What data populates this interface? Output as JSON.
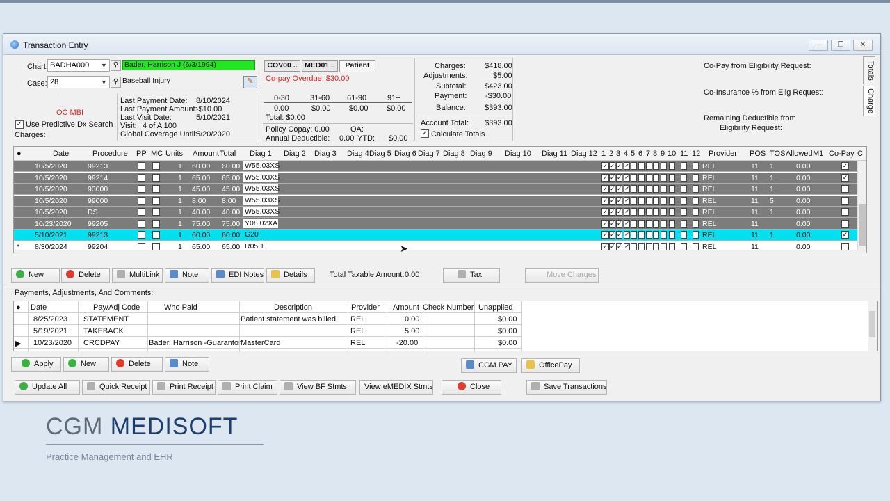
{
  "window": {
    "title": "Transaction Entry",
    "minimize": "—",
    "restore": "❐",
    "close": "✕"
  },
  "patient": {
    "chart_label": "Chart:",
    "chart_value": "BADHA000",
    "patient_name": "Bader, Harrison J (6/3/1994)",
    "case_label": "Case:",
    "case_value": "28",
    "case_desc": "Baseball Injury",
    "oc_mbi": "OC MBI",
    "predictive_label": "Use Predictive Dx Search",
    "charges_label": "Charges:",
    "last_payment_date_label": "Last Payment Date:",
    "last_payment_date": "8/10/2024",
    "last_payment_amount_label": "Last Payment Amount:",
    "last_payment_amount": "-$10.00",
    "last_visit_date_label": "Last Visit Date:",
    "last_visit_date": "5/10/2021",
    "visit_label": "Visit:",
    "visit_value": "4   of  A 100",
    "global_cov_label": "Global Coverage Until:",
    "global_cov_value": "5/20/2020"
  },
  "insurance": {
    "tabs": [
      "COV00 ..",
      "MED01 ..",
      "Patient"
    ],
    "copay_overdue": "Co-pay Overdue: $30.00",
    "aging_headers": [
      "0-30",
      "31-60",
      "61-90",
      "91+"
    ],
    "aging_values": [
      "0.00",
      "$0.00",
      "$0.00",
      "$0.00"
    ],
    "total": "Total: $0.00",
    "policy_copay": "Policy Copay: 0.00",
    "oa": "OA:",
    "annual_deductible": "Annual Deductible:",
    "annual_deductible_value": "0.00",
    "ytd": "YTD:",
    "ytd_value": "$0.00"
  },
  "totals": {
    "charges_label": "Charges:",
    "charges": "$418.00",
    "adjustments_label": "Adjustments:",
    "adjustments": "$5.00",
    "subtotal_label": "Subtotal:",
    "subtotal": "$423.00",
    "payment_label": "Payment:",
    "payment": "-$30.00",
    "balance_label": "Balance:",
    "balance": "$393.00",
    "account_total_label": "Account Total:",
    "account_total": "$393.00",
    "calculate_totals": "Calculate Totals"
  },
  "eligibility": {
    "copay": "Co-Pay from Eligibility Request:",
    "coins": "Co-Insurance % from Elig Request:",
    "deductible_1": "Remaining Deductible from",
    "deductible_2": "Eligibility Request:"
  },
  "side_tabs": [
    "Totals",
    "Charge"
  ],
  "charge_grid": {
    "headers": [
      "Date",
      "Procedure",
      "PP",
      "MC",
      "Units",
      "Amount",
      "Total",
      "Diag 1",
      "Diag 2",
      "Diag 3",
      "Diag 4",
      "Diag 5",
      "Diag 6",
      "Diag 7",
      "Diag 8",
      "Diag 9",
      "Diag 10",
      "Diag 11",
      "Diag 12",
      "1",
      "2",
      "3",
      "4",
      "5",
      "6",
      "7",
      "8",
      "9",
      "10",
      "11",
      "12",
      "Provider",
      "POS",
      "TOS",
      "Allowed",
      "M1",
      "Co-Pay",
      "C"
    ],
    "rows": [
      {
        "date": "10/5/2020",
        "proc": "99213",
        "units": "1",
        "amount": "60.00",
        "total": "60.00",
        "diag1": "W55.03XS",
        "provider": "REL",
        "pos": "11",
        "tos": "1",
        "allowed": "0.00",
        "copay": true
      },
      {
        "date": "10/5/2020",
        "proc": "99214",
        "units": "1",
        "amount": "65.00",
        "total": "65.00",
        "diag1": "W55.03XS",
        "provider": "REL",
        "pos": "11",
        "tos": "1",
        "allowed": "0.00",
        "copay": true
      },
      {
        "date": "10/5/2020",
        "proc": "93000",
        "units": "1",
        "amount": "45.00",
        "total": "45.00",
        "diag1": "W55.03XS",
        "provider": "REL",
        "pos": "11",
        "tos": "1",
        "allowed": "0.00",
        "copay": false
      },
      {
        "date": "10/5/2020",
        "proc": "99000",
        "units": "1",
        "amount": "8.00",
        "total": "8.00",
        "diag1": "W55.03XS",
        "provider": "REL",
        "pos": "11",
        "tos": "5",
        "allowed": "0.00",
        "copay": false
      },
      {
        "date": "10/5/2020",
        "proc": "DS",
        "units": "1",
        "amount": "40.00",
        "total": "40.00",
        "diag1": "W55.03XS",
        "provider": "REL",
        "pos": "11",
        "tos": "1",
        "allowed": "0.00",
        "copay": false
      },
      {
        "date": "10/23/2020",
        "proc": "99205",
        "units": "1",
        "amount": "75.00",
        "total": "75.00",
        "diag1": "Y08.02XA",
        "provider": "REL",
        "pos": "11",
        "tos": "",
        "allowed": "0.00",
        "copay": false
      },
      {
        "date": "5/10/2021",
        "proc": "99213",
        "units": "1",
        "amount": "60.00",
        "total": "60.00",
        "diag1": "G20",
        "provider": "REL",
        "pos": "11",
        "tos": "1",
        "allowed": "0.00",
        "copay": true
      },
      {
        "date": "8/30/2024",
        "proc": "99204",
        "units": "1",
        "amount": "65.00",
        "total": "65.00",
        "diag1": "R05.1",
        "provider": "REL",
        "pos": "11",
        "tos": "",
        "allowed": "0.00",
        "copay": false
      }
    ]
  },
  "charge_buttons": {
    "new": "New",
    "delete": "Delete",
    "multilink": "MultiLink",
    "note": "Note",
    "edi_notes": "EDI Notes",
    "details": "Details",
    "total_taxable": "Total Taxable Amount:",
    "total_taxable_value": "0.00",
    "tax": "Tax",
    "move_charges": "Move Charges"
  },
  "payments": {
    "section_title": "Payments, Adjustments, And Comments:",
    "headers": [
      "Date",
      "Pay/Adj Code",
      "Who Paid",
      "Description",
      "Provider",
      "Amount",
      "Check Number",
      "Unapplied"
    ],
    "rows": [
      {
        "date": "8/25/2023",
        "code": "STATEMENT",
        "who": "",
        "desc": "Patient statement was billed",
        "provider": "REL",
        "amount": "0.00",
        "check": "",
        "unapplied": "$0.00"
      },
      {
        "date": "5/19/2021",
        "code": "TAKEBACK",
        "who": "",
        "desc": "",
        "provider": "REL",
        "amount": "5.00",
        "check": "",
        "unapplied": "$0.00"
      },
      {
        "date": "10/23/2020",
        "code": "CRCDPAY",
        "who": "Bader, Harrison -Guarantor",
        "desc": "MasterCard",
        "provider": "REL",
        "amount": "-20.00",
        "check": "",
        "unapplied": "$0.00"
      }
    ]
  },
  "payment_buttons": {
    "apply": "Apply",
    "new": "New",
    "delete": "Delete",
    "note": "Note",
    "cgm_pay": "CGM PAY",
    "office_pay": "OfficePay"
  },
  "bottom_buttons": {
    "update_all": "Update All",
    "quick_receipt": "Quick Receipt",
    "print_receipt": "Print Receipt",
    "print_claim": "Print Claim",
    "view_bf": "View BF Stmts",
    "view_emedix": "View eMEDIX Stmts",
    "close": "Close",
    "save": "Save Transactions"
  },
  "branding": {
    "cgm": "CGM",
    "medisoft": "MEDISOFT",
    "tagline": "Practice Management and EHR"
  }
}
